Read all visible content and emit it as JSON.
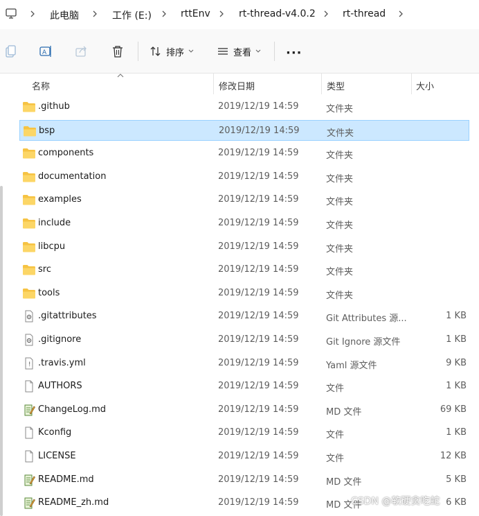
{
  "breadcrumb": {
    "icon": "computer-icon",
    "items": [
      "此电脑",
      "工作 (E:)",
      "rttEnv",
      "rt-thread-v4.0.2",
      "rt-thread"
    ]
  },
  "toolbar": {
    "copy_icon": "copy-icon",
    "rename_icon": "rename-icon",
    "share_icon": "share-icon",
    "delete_icon": "delete-icon",
    "sort_label": "排序",
    "view_label": "查看",
    "more_label": "···"
  },
  "columns": {
    "name": "名称",
    "modified": "修改日期",
    "type": "类型",
    "size": "大小"
  },
  "files": [
    {
      "name": ".github",
      "date": "2019/12/19 14:59",
      "type": "文件夹",
      "size": "",
      "icon": "folder-icon"
    },
    {
      "name": "bsp",
      "date": "2019/12/19 14:59",
      "type": "文件夹",
      "size": "",
      "icon": "folder-icon",
      "selected": true
    },
    {
      "name": "components",
      "date": "2019/12/19 14:59",
      "type": "文件夹",
      "size": "",
      "icon": "folder-icon"
    },
    {
      "name": "documentation",
      "date": "2019/12/19 14:59",
      "type": "文件夹",
      "size": "",
      "icon": "folder-icon"
    },
    {
      "name": "examples",
      "date": "2019/12/19 14:59",
      "type": "文件夹",
      "size": "",
      "icon": "folder-icon"
    },
    {
      "name": "include",
      "date": "2019/12/19 14:59",
      "type": "文件夹",
      "size": "",
      "icon": "folder-icon"
    },
    {
      "name": "libcpu",
      "date": "2019/12/19 14:59",
      "type": "文件夹",
      "size": "",
      "icon": "folder-icon"
    },
    {
      "name": "src",
      "date": "2019/12/19 14:59",
      "type": "文件夹",
      "size": "",
      "icon": "folder-icon"
    },
    {
      "name": "tools",
      "date": "2019/12/19 14:59",
      "type": "文件夹",
      "size": "",
      "icon": "folder-icon"
    },
    {
      "name": ".gitattributes",
      "date": "2019/12/19 14:59",
      "type": "Git Attributes 源...",
      "size": "1 KB",
      "icon": "gear-file-icon"
    },
    {
      "name": ".gitignore",
      "date": "2019/12/19 14:59",
      "type": "Git Ignore 源文件",
      "size": "1 KB",
      "icon": "gear-file-icon"
    },
    {
      "name": ".travis.yml",
      "date": "2019/12/19 14:59",
      "type": "Yaml 源文件",
      "size": "9 KB",
      "icon": "yaml-file-icon"
    },
    {
      "name": "AUTHORS",
      "date": "2019/12/19 14:59",
      "type": "文件",
      "size": "1 KB",
      "icon": "blank-file-icon"
    },
    {
      "name": "ChangeLog.md",
      "date": "2019/12/19 14:59",
      "type": "MD 文件",
      "size": "69 KB",
      "icon": "notepad-file-icon"
    },
    {
      "name": "Kconfig",
      "date": "2019/12/19 14:59",
      "type": "文件",
      "size": "1 KB",
      "icon": "blank-file-icon"
    },
    {
      "name": "LICENSE",
      "date": "2019/12/19 14:59",
      "type": "文件",
      "size": "12 KB",
      "icon": "blank-file-icon"
    },
    {
      "name": "README.md",
      "date": "2019/12/19 14:59",
      "type": "MD 文件",
      "size": "5 KB",
      "icon": "notepad-file-icon"
    },
    {
      "name": "README_zh.md",
      "date": "2019/12/19 14:59",
      "type": "MD 文件",
      "size": "6 KB",
      "icon": "notepad-file-icon"
    }
  ],
  "watermark": "CSDN @软硬贪吃蛇",
  "colors": {
    "selection": "#cce8ff",
    "selection_border": "#99d1ff",
    "folder": "#f6c343",
    "toolbar_bg": "#f9f9f9"
  }
}
